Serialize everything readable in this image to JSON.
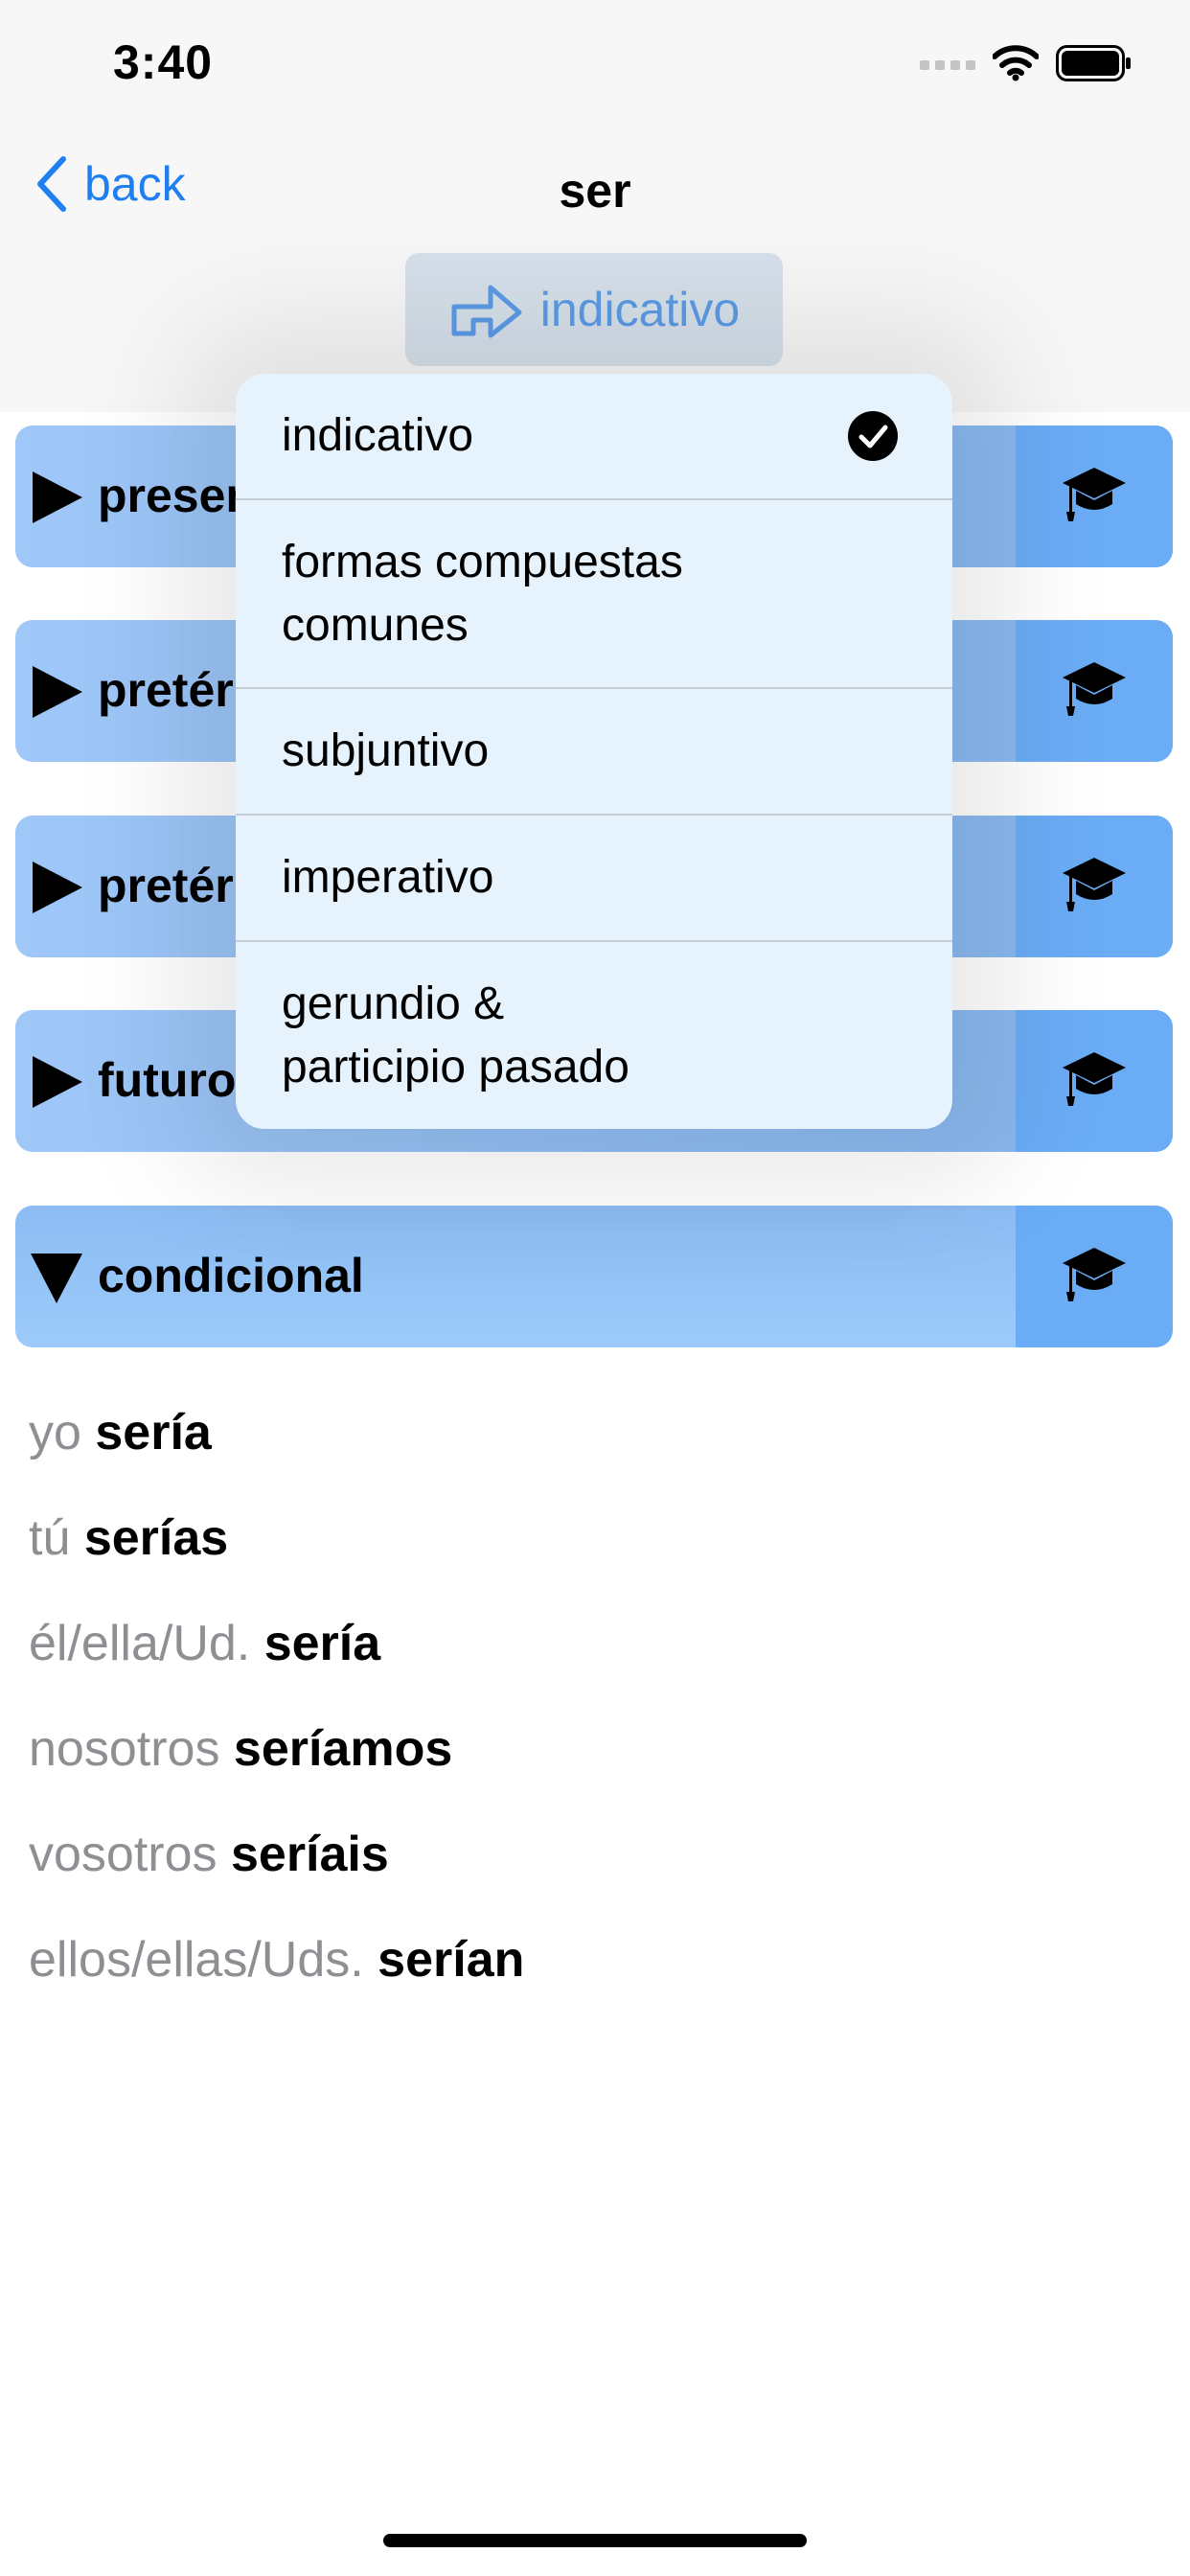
{
  "status_bar": {
    "time": "3:40"
  },
  "nav": {
    "back_label": "back",
    "title": "ser"
  },
  "mood_button": {
    "label": "indicativo",
    "icon": "arrow-right-outline-icon"
  },
  "tenses": [
    {
      "label": "presente",
      "expanded": false
    },
    {
      "label": "pretérito",
      "expanded": false
    },
    {
      "label": "pretérito",
      "expanded": false
    },
    {
      "label": "futuro",
      "expanded": false
    },
    {
      "label": "condicional",
      "expanded": true
    }
  ],
  "study_icon": "graduation-cap-icon",
  "conjugation": [
    {
      "pronoun": "yo",
      "form": "sería"
    },
    {
      "pronoun": "tú",
      "form": "serías"
    },
    {
      "pronoun": "él/ella/Ud.",
      "form": "sería"
    },
    {
      "pronoun": "nosotros",
      "form": "seríamos"
    },
    {
      "pronoun": "vosotros",
      "form": "seríais"
    },
    {
      "pronoun": "ellos/ellas/Uds.",
      "form": "serían"
    }
  ],
  "dropdown": {
    "items": [
      {
        "line1": "indicativo",
        "line2": "",
        "selected": true
      },
      {
        "line1": "formas compuestas",
        "line2": "comunes",
        "selected": false
      },
      {
        "line1": "subjuntivo",
        "line2": "",
        "selected": false
      },
      {
        "line1": "imperativo",
        "line2": "",
        "selected": false
      },
      {
        "line1": "gerundio &",
        "line2": "participio pasado",
        "selected": false
      }
    ]
  },
  "colors": {
    "accent": "#1f7ef0",
    "row_blue": "#86b6ee",
    "study_blue": "#6aacf5",
    "menu_bg": "#e6f2fc"
  }
}
